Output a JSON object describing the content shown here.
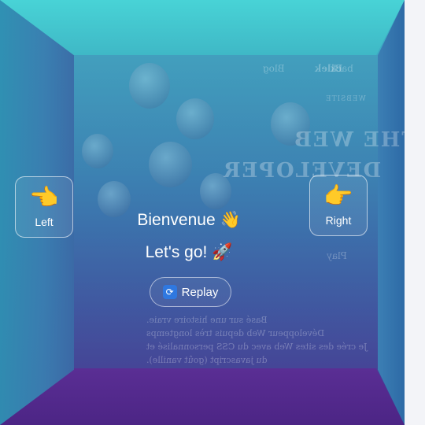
{
  "buttons": {
    "left": {
      "label": "Left",
      "icon": "hand-pointing-left-icon",
      "glyph": "👈"
    },
    "right": {
      "label": "Right",
      "icon": "hand-pointing-right-icon",
      "glyph": "👉"
    },
    "replay": {
      "label": "Replay",
      "icon": "refresh-icon",
      "glyph": "🔄"
    }
  },
  "greeting": {
    "line1": "Bienvenue",
    "line1_emoji": "👋",
    "line2": "Let's go!",
    "line2_emoji": "🚀"
  },
  "background_site": {
    "nav": {
      "back": "back",
      "bilek": "Bilek",
      "blog": "Blog"
    },
    "website_tag": "WEBSITE",
    "title_line1": "THE WEB",
    "title_line2": "DEVELOPER",
    "play_label": "Play",
    "bio": [
      "Basé sur une histoire vraie.",
      "Développeur Web depuis très longtemps",
      "Je crée des sites Web avec du CSS personnalisé et",
      "du javascript (goût vanille)."
    ]
  },
  "colors": {
    "top_wall": "#48d3d6",
    "bottom_wall": "#5a2e94",
    "replay_icon": "#2f78e0"
  }
}
